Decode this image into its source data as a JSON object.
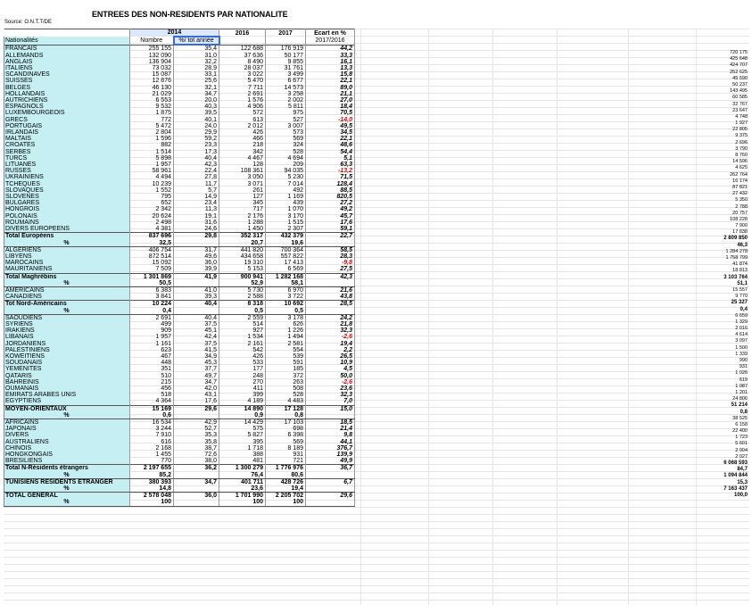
{
  "sheet_title": "ENTREES DES NON-RESIDENTS PAR NATIONALITE",
  "source": "Source: O.N.T.T/DE",
  "headers": {
    "col_2014": "2014",
    "col_2016": "2016",
    "col_2017": "2017",
    "col_ecart": "Ecart en %",
    "row2_name": "Nationalités",
    "row2_nombre": "Nombre",
    "row2_pct": "%/ tot année",
    "row2_ecart": "2017/2016"
  },
  "rows": [
    {
      "name": "FRANCAIS",
      "n14": "255 155",
      "p14": "35,4",
      "n16": "122 688",
      "n17": "176 919",
      "e": "44,2",
      "type": "nat"
    },
    {
      "name": "ALLEMANDS",
      "n14": "132 090",
      "p14": "31,0",
      "n16": "37 636",
      "n17": "50 177",
      "e": "33,3",
      "type": "nat"
    },
    {
      "name": "ANGLAIS",
      "n14": "136 904",
      "p14": "32,2",
      "n16": "8 490",
      "n17": "9 855",
      "e": "16,1",
      "type": "nat"
    },
    {
      "name": "ITALIENS",
      "n14": "73 032",
      "p14": "28,9",
      "n16": "28 037",
      "n17": "31 761",
      "e": "13,3",
      "type": "nat"
    },
    {
      "name": "SCANDINAVES",
      "n14": "15 087",
      "p14": "33,1",
      "n16": "3 022",
      "n17": "3 499",
      "e": "15,8",
      "type": "nat"
    },
    {
      "name": "SUISSES",
      "n14": "12 876",
      "p14": "25,6",
      "n16": "5 470",
      "n17": "6 677",
      "e": "22,1",
      "type": "nat"
    },
    {
      "name": "BELGES",
      "n14": "46 130",
      "p14": "32,1",
      "n16": "7 711",
      "n17": "14 573",
      "e": "89,0",
      "type": "nat"
    },
    {
      "name": "HOLLANDAIS",
      "n14": "21 029",
      "p14": "34,7",
      "n16": "2 691",
      "n17": "3 258",
      "e": "21,1",
      "type": "nat"
    },
    {
      "name": "AUTRICHIENS",
      "n14": "6 553",
      "p14": "20,0",
      "n16": "1 576",
      "n17": "2 002",
      "e": "27,0",
      "type": "nat"
    },
    {
      "name": "ESPAGNOLS",
      "n14": "9 532",
      "p14": "40,3",
      "n16": "4 906",
      "n17": "5 811",
      "e": "18,4",
      "type": "nat"
    },
    {
      "name": "LUXEMBOURGEOIS",
      "n14": "1 875",
      "p14": "39,5",
      "n16": "572",
      "n17": "975",
      "e": "70,5",
      "type": "nat"
    },
    {
      "name": "GRECS",
      "n14": "772",
      "p14": "40,1",
      "n16": "613",
      "n17": "527",
      "e": "-14,0",
      "type": "nat",
      "neg": true
    },
    {
      "name": "PORTUGAIS",
      "n14": "5 472",
      "p14": "24,0",
      "n16": "2 012",
      "n17": "3 007",
      "e": "49,5",
      "type": "nat"
    },
    {
      "name": "IRLANDAIS",
      "n14": "2 804",
      "p14": "29,9",
      "n16": "426",
      "n17": "573",
      "e": "34,5",
      "type": "nat"
    },
    {
      "name": "MALTAIS",
      "n14": "1 596",
      "p14": "59,2",
      "n16": "466",
      "n17": "569",
      "e": "22,1",
      "type": "nat"
    },
    {
      "name": "CROATES",
      "n14": "882",
      "p14": "23,3",
      "n16": "218",
      "n17": "324",
      "e": "48,6",
      "type": "nat"
    },
    {
      "name": "SERBES",
      "n14": "1 514",
      "p14": "17,3",
      "n16": "342",
      "n17": "528",
      "e": "54,4",
      "type": "nat"
    },
    {
      "name": "TURCS",
      "n14": "5 898",
      "p14": "40,4",
      "n16": "4 467",
      "n17": "4 694",
      "e": "5,1",
      "type": "nat"
    },
    {
      "name": "LITUANES",
      "n14": "1 957",
      "p14": "42,3",
      "n16": "128",
      "n17": "209",
      "e": "63,3",
      "type": "nat"
    },
    {
      "name": "RUSSES",
      "n14": "58 961",
      "p14": "22,4",
      "n16": "108 361",
      "n17": "94 035",
      "e": "-13,2",
      "type": "nat",
      "neg": true
    },
    {
      "name": "UKRAINIENS",
      "n14": "4 494",
      "p14": "27,8",
      "n16": "3 050",
      "n17": "5 230",
      "e": "71,5",
      "type": "nat"
    },
    {
      "name": "TCHEQUES",
      "n14": "10 239",
      "p14": "11,7",
      "n16": "3 071",
      "n17": "7 014",
      "e": "128,4",
      "type": "nat"
    },
    {
      "name": "SLOVAQUES",
      "n14": "1 552",
      "p14": "5,7",
      "n16": "261",
      "n17": "492",
      "e": "88,5",
      "type": "nat"
    },
    {
      "name": "SLOVENES",
      "n14": "795",
      "p14": "14,9",
      "n16": "127",
      "n17": "1 169",
      "e": "820,5",
      "type": "nat"
    },
    {
      "name": "BULGARES",
      "n14": "652",
      "p14": "23,4",
      "n16": "345",
      "n17": "439",
      "e": "27,2",
      "type": "nat"
    },
    {
      "name": "HONGROIS",
      "n14": "2 342",
      "p14": "11,3",
      "n16": "717",
      "n17": "1 070",
      "e": "49,2",
      "type": "nat"
    },
    {
      "name": "POLONAIS",
      "n14": "20 624",
      "p14": "19,1",
      "n16": "2 176",
      "n17": "3 170",
      "e": "45,7",
      "type": "nat"
    },
    {
      "name": "ROUMAINS",
      "n14": "2 498",
      "p14": "31,6",
      "n16": "1 288",
      "n17": "1 515",
      "e": "17,6",
      "type": "nat"
    },
    {
      "name": "DIVERS EUROPEENS",
      "n14": "4 381",
      "p14": "24,6",
      "n16": "1 450",
      "n17": "2 307",
      "e": "59,1",
      "type": "nat"
    },
    {
      "name": "Total Européens",
      "n14": "837 696",
      "p14": "29,8",
      "n16": "352 317",
      "n17": "432 379",
      "e": "22,7",
      "type": "total"
    },
    {
      "name": "%",
      "n14": "32,5",
      "p14": "",
      "n16": "20,7",
      "n17": "19,6",
      "e": "",
      "type": "pct"
    },
    {
      "name": "ALGERIENS",
      "n14": "406 754",
      "p14": "31,7",
      "n16": "441 820",
      "n17": "700 364",
      "e": "58,5",
      "type": "nat"
    },
    {
      "name": "LIBYENS",
      "n14": "872 514",
      "p14": "49,6",
      "n16": "434 658",
      "n17": "557 822",
      "e": "28,3",
      "type": "nat"
    },
    {
      "name": "MAROCAINS",
      "n14": "15 092",
      "p14": "36,0",
      "n16": "19 310",
      "n17": "17 413",
      "e": "-9,8",
      "type": "nat",
      "neg": true
    },
    {
      "name": "MAURITANIENS",
      "n14": "7 509",
      "p14": "39,9",
      "n16": "5 153",
      "n17": "6 569",
      "e": "27,5",
      "type": "nat"
    },
    {
      "name": "Total Maghrébins",
      "n14": "1 301 869",
      "p14": "41,9",
      "n16": "900 941",
      "n17": "1 282 168",
      "e": "42,3",
      "type": "total"
    },
    {
      "name": "%",
      "n14": "50,5",
      "p14": "",
      "n16": "52,9",
      "n17": "58,1",
      "e": "",
      "type": "pct"
    },
    {
      "name": "AMERICAINS",
      "n14": "6 383",
      "p14": "41,0",
      "n16": "5 730",
      "n17": "6 970",
      "e": "21,6",
      "type": "nat"
    },
    {
      "name": "CANADIENS",
      "n14": "3 841",
      "p14": "39,3",
      "n16": "2 588",
      "n17": "3 722",
      "e": "43,8",
      "type": "nat"
    },
    {
      "name": "Tot Nord-Américains",
      "n14": "10 224",
      "p14": "40,4",
      "n16": "8 318",
      "n17": "10 692",
      "e": "28,5",
      "type": "total"
    },
    {
      "name": "%",
      "n14": "0,4",
      "p14": "",
      "n16": "0,5",
      "n17": "0,5",
      "e": "",
      "type": "pct"
    },
    {
      "name": "SAOUDIENS",
      "n14": "2 691",
      "p14": "40,4",
      "n16": "2 559",
      "n17": "3 178",
      "e": "24,2",
      "type": "nat"
    },
    {
      "name": "SYRIENS",
      "n14": "499",
      "p14": "37,5",
      "n16": "514",
      "n17": "626",
      "e": "21,8",
      "type": "nat"
    },
    {
      "name": "IRAKIENS",
      "n14": "909",
      "p14": "45,1",
      "n16": "927",
      "n17": "1 226",
      "e": "32,3",
      "type": "nat"
    },
    {
      "name": "LIBANAIS",
      "n14": "1 957",
      "p14": "42,4",
      "n16": "1 534",
      "n17": "1 494",
      "e": "-2,6",
      "type": "nat",
      "neg": true
    },
    {
      "name": "JORDANIENS",
      "n14": "1 161",
      "p14": "37,5",
      "n16": "2 161",
      "n17": "2 581",
      "e": "19,4",
      "type": "nat"
    },
    {
      "name": "PALESTINIENS",
      "n14": "623",
      "p14": "41,5",
      "n16": "542",
      "n17": "554",
      "e": "2,2",
      "type": "nat"
    },
    {
      "name": "KOWEITIENS",
      "n14": "467",
      "p14": "34,9",
      "n16": "426",
      "n17": "539",
      "e": "26,5",
      "type": "nat"
    },
    {
      "name": "SOUDANAIS",
      "n14": "448",
      "p14": "45,3",
      "n16": "533",
      "n17": "591",
      "e": "10,9",
      "type": "nat"
    },
    {
      "name": "YEMENITES",
      "n14": "351",
      "p14": "37,7",
      "n16": "177",
      "n17": "185",
      "e": "4,5",
      "type": "nat"
    },
    {
      "name": "QATARIS",
      "n14": "510",
      "p14": "49,7",
      "n16": "248",
      "n17": "372",
      "e": "50,0",
      "type": "nat"
    },
    {
      "name": "BAHREINIS",
      "n14": "215",
      "p14": "34,7",
      "n16": "270",
      "n17": "263",
      "e": "-2,6",
      "type": "nat",
      "neg": true
    },
    {
      "name": "OUMANAIS",
      "n14": "456",
      "p14": "42,0",
      "n16": "411",
      "n17": "508",
      "e": "23,6",
      "type": "nat"
    },
    {
      "name": "EMIRATS ARABES UNIS",
      "n14": "518",
      "p14": "43,1",
      "n16": "399",
      "n17": "528",
      "e": "32,3",
      "type": "nat"
    },
    {
      "name": "EGYPTIENS",
      "n14": "4 364",
      "p14": "17,6",
      "n16": "4 189",
      "n17": "4 483",
      "e": "7,0",
      "type": "nat"
    },
    {
      "name": "MOYEN-ORIENTAUX",
      "n14": "15 169",
      "p14": "29,6",
      "n16": "14 890",
      "n17": "17 128",
      "e": "15,0",
      "type": "total"
    },
    {
      "name": "%",
      "n14": "0,6",
      "p14": "",
      "n16": "0,9",
      "n17": "0,8",
      "e": "",
      "type": "pct"
    },
    {
      "name": "AFRICAINS",
      "n14": "16 534",
      "p14": "42,9",
      "n16": "14 429",
      "n17": "17 103",
      "e": "18,5",
      "type": "nat"
    },
    {
      "name": "JAPONAIS",
      "n14": "3 244",
      "p14": "52,7",
      "n16": "575",
      "n17": "698",
      "e": "21,4",
      "type": "nat"
    },
    {
      "name": "DIVERS",
      "n14": "7 910",
      "p14": "35,3",
      "n16": "5 827",
      "n17": "6 398",
      "e": "9,8",
      "type": "nat"
    },
    {
      "name": "AUSTRALIENS",
      "n14": "616",
      "p14": "35,8",
      "n16": "395",
      "n17": "569",
      "e": "44,1",
      "type": "nat"
    },
    {
      "name": "CHINOIS",
      "n14": "2 168",
      "p14": "38,7",
      "n16": "1 718",
      "n17": "8 189",
      "e": "376,7",
      "type": "nat"
    },
    {
      "name": "HONGKONGAIS",
      "n14": "1 455",
      "p14": "72,6",
      "n16": "388",
      "n17": "931",
      "e": "139,9",
      "type": "nat"
    },
    {
      "name": "BRESILIENS",
      "n14": "770",
      "p14": "38,0",
      "n16": "481",
      "n17": "721",
      "e": "49,9",
      "type": "nat"
    },
    {
      "name": "Total N-Résidents étrangers",
      "n14": "2 197 655",
      "p14": "36,2",
      "n16": "1 300 279",
      "n17": "1 776 976",
      "e": "36,7",
      "type": "total"
    },
    {
      "name": "%",
      "n14": "85,2",
      "p14": "",
      "n16": "76,4",
      "n17": "80,6",
      "e": "",
      "type": "pct"
    },
    {
      "name": "TUNISIENS  RESIDENTS ETRANGER",
      "n14": "380 393",
      "p14": "34,7",
      "n16": "401 711",
      "n17": "428 726",
      "e": "6,7",
      "type": "total"
    },
    {
      "name": "%",
      "n14": "14,8",
      "p14": "",
      "n16": "23,6",
      "n17": "19,4",
      "e": "",
      "type": "pct"
    },
    {
      "name": "TOTAL  GENERAL",
      "n14": "2 578 048",
      "p14": "36,0",
      "n16": "1 701 990",
      "n17": "2 205 702",
      "e": "29,6",
      "type": "total"
    },
    {
      "name": "%",
      "n14": "100",
      "p14": "",
      "n16": "100",
      "n17": "100",
      "e": "",
      "type": "pct"
    }
  ],
  "side_values": [
    "720 175",
    "425 648",
    "424 707",
    "252 625",
    "45 590",
    "50 237",
    "143 495",
    "60 585",
    "32 767",
    "23 647",
    "4 748",
    "1 927",
    "22 805",
    "9 375",
    "2 696",
    "3 790",
    "8 760",
    "14 596",
    "4 625",
    "262 764",
    "16 174",
    "87 821",
    "27 432",
    "5 350",
    "2 788",
    "20 757",
    "108 228",
    "7 900",
    "17 838",
    "2 809 850",
    "46,3",
    "1 284 278",
    "1 758 799",
    "41 874",
    "18 813",
    "3 103 764",
    "51,1",
    "15 557",
    "9 770",
    "25 327",
    "0,4",
    "6 659",
    "1 329",
    "2 016",
    "4 614",
    "3 097",
    "1 500",
    "1 339",
    "990",
    "931",
    "1 026",
    "619",
    "1 087",
    "1 201",
    "24 806",
    "51 214",
    "0,8",
    "38 525",
    "6 158",
    "22 400",
    "1 723",
    "5 601",
    "2 004",
    "2 027",
    "6 068 593",
    "84,7",
    "1 094 844",
    "15,3",
    "7 163 437",
    "100,0"
  ]
}
